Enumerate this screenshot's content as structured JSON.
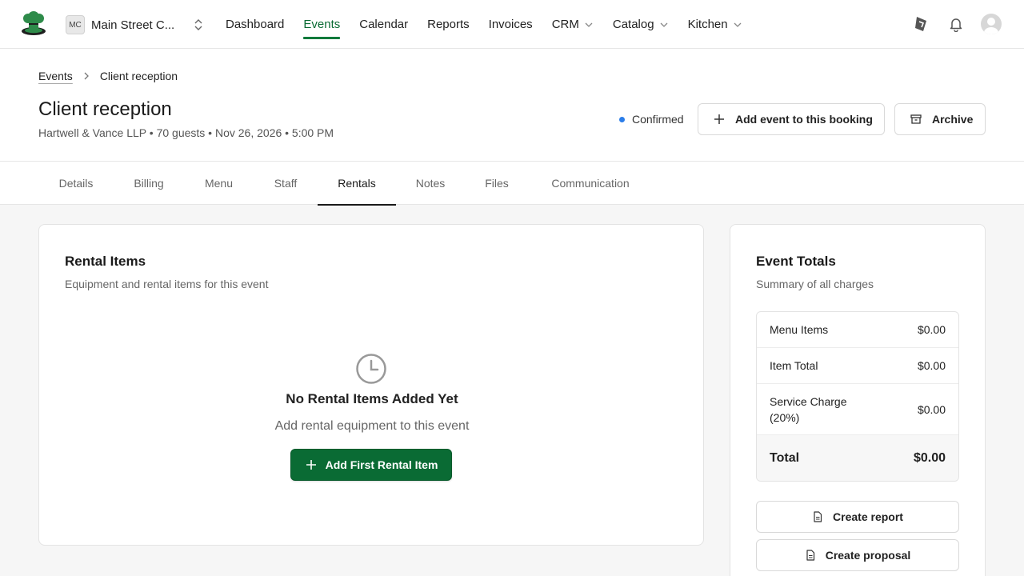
{
  "topnav": {
    "org_initials": "MC",
    "org_name": "Main Street C...",
    "items": [
      {
        "label": "Dashboard"
      },
      {
        "label": "Events"
      },
      {
        "label": "Calendar"
      },
      {
        "label": "Reports"
      },
      {
        "label": "Invoices"
      },
      {
        "label": "CRM"
      },
      {
        "label": "Catalog"
      },
      {
        "label": "Kitchen"
      }
    ],
    "active": "Events",
    "accent_color": "#0a7a3b"
  },
  "breadcrumb": {
    "parent": "Events",
    "current": "Client reception"
  },
  "event": {
    "title": "Client reception",
    "subtitle": "Hartwell & Vance LLP • 70 guests • Nov 26, 2026 • 5:00 PM",
    "status": "Confirmed",
    "status_color": "#2b7de9"
  },
  "actions": {
    "add_event": "Add event to this booking",
    "archive": "Archive"
  },
  "tabs": [
    {
      "label": "Details"
    },
    {
      "label": "Billing"
    },
    {
      "label": "Menu"
    },
    {
      "label": "Staff"
    },
    {
      "label": "Rentals"
    },
    {
      "label": "Notes"
    },
    {
      "label": "Files"
    },
    {
      "label": "Communication"
    }
  ],
  "active_tab": "Rentals",
  "rentals": {
    "title": "Rental Items",
    "subtitle": "Equipment and rental items for this event",
    "empty_title": "No Rental Items Added Yet",
    "empty_subtitle": "Add rental equipment to this event",
    "add_button": "Add First Rental Item"
  },
  "totals": {
    "title": "Event Totals",
    "subtitle": "Summary of all charges",
    "rows": [
      {
        "label": "Menu Items",
        "value": "$0.00"
      },
      {
        "label": "Item Total",
        "value": "$0.00"
      },
      {
        "label": "Service Charge (20%)",
        "value": "$0.00"
      }
    ],
    "total_label": "Total",
    "total_value": "$0.00",
    "create_report": "Create report",
    "create_proposal": "Create proposal"
  }
}
